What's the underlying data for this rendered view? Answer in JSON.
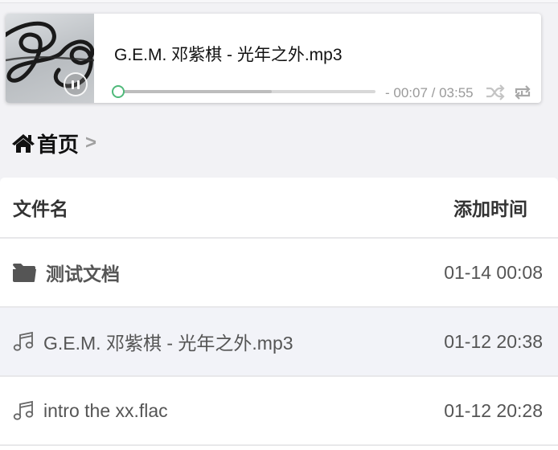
{
  "player": {
    "title": "G.E.M. 邓紫棋 - 光年之外.mp3",
    "time": "- 00:07 / 03:55",
    "progress_fraction": 0.6
  },
  "breadcrumb": {
    "home": "首页",
    "separator": ">"
  },
  "table": {
    "columns": {
      "name": "文件名",
      "added": "添加时间"
    },
    "rows": [
      {
        "name": "测试文档",
        "added": "01-14 00:08",
        "icon": "folder-icon"
      },
      {
        "name": "G.E.M. 邓紫棋 - 光年之外.mp3",
        "added": "01-12 20:38",
        "icon": "music-note-icon"
      },
      {
        "name": "intro the xx.flac",
        "added": "01-12 20:28",
        "icon": "music-note-icon"
      }
    ]
  }
}
